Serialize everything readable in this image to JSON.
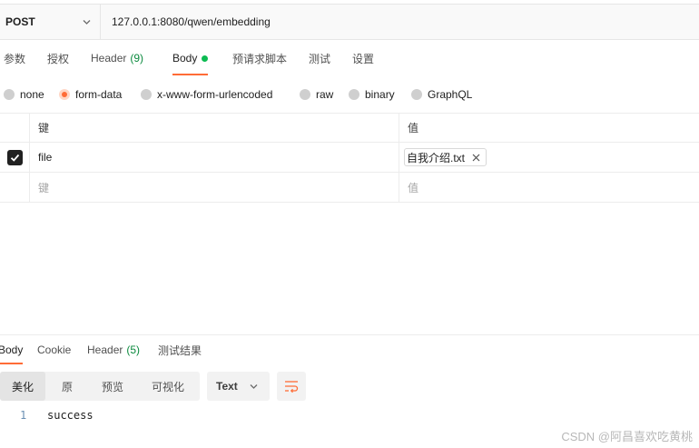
{
  "request": {
    "method": "POST",
    "url": "127.0.0.1:8080/qwen/embedding"
  },
  "request_tabs": [
    {
      "label": "参数"
    },
    {
      "label": "授权"
    },
    {
      "label": "Header",
      "count": "(9)"
    },
    {
      "label": "Body"
    },
    {
      "label": "预请求脚本"
    },
    {
      "label": "测试"
    },
    {
      "label": "设置"
    }
  ],
  "body_types": [
    {
      "label": "none",
      "selected": false
    },
    {
      "label": "form-data",
      "selected": true
    },
    {
      "label": "x-www-form-urlencoded",
      "selected": false
    },
    {
      "label": "raw",
      "selected": false
    },
    {
      "label": "binary",
      "selected": false
    },
    {
      "label": "GraphQL",
      "selected": false
    }
  ],
  "form_table": {
    "key_header": "键",
    "value_header": "值",
    "rows": [
      {
        "checked": true,
        "key": "file",
        "value_file": "自我介绍.txt"
      }
    ],
    "new_row": {
      "key_placeholder": "键",
      "value_placeholder": "值"
    }
  },
  "response_tabs": [
    {
      "label": "Body"
    },
    {
      "label": "Cookie"
    },
    {
      "label": "Header",
      "count": "(5)"
    },
    {
      "label": "测试结果"
    }
  ],
  "response_view": {
    "modes": [
      "美化",
      "原",
      "预览",
      "可视化"
    ],
    "active_mode": "美化",
    "format": "Text"
  },
  "response_body": {
    "line_number": "1",
    "text": "success"
  },
  "watermark": "CSDN @阿昌喜欢吃黄桃",
  "colors": {
    "accent": "#ff6c37",
    "count_green": "#0b8a3e",
    "status_dot": "#0cbb52"
  }
}
